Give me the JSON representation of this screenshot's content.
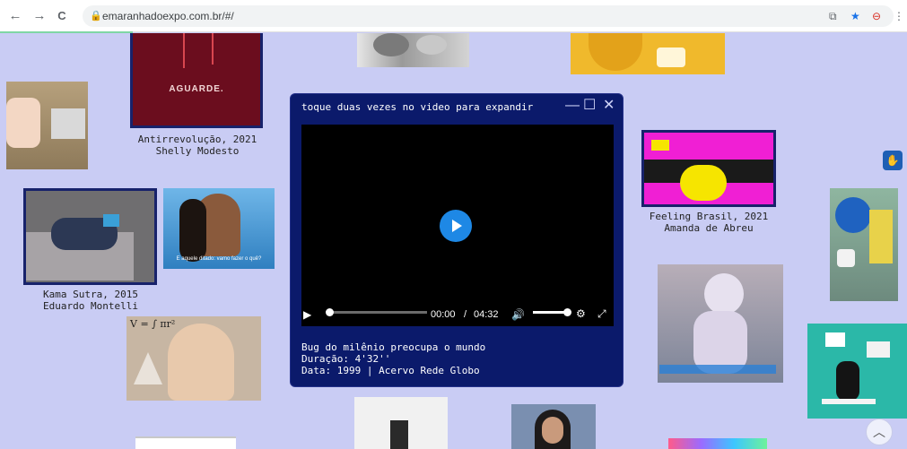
{
  "browser": {
    "back_icon": "←",
    "forward_icon": "→",
    "reload_icon": "C",
    "lock_icon": "🔒",
    "url": "emaranhadoexpo.com.br/#/",
    "ext1": "⧉",
    "star_icon": "★",
    "ext2": "⊖",
    "menu_icon": "⋮"
  },
  "artworks": [
    {
      "title": "Antirrevolução, 2021",
      "artist": "Shelly Modesto",
      "overlay_text": "AGUARDE."
    },
    {
      "title": "Kama Sutra, 2015",
      "artist": "Eduardo Montelli"
    },
    {
      "title": "Feeling Brasil, 2021",
      "artist": "Amanda de Abreu"
    }
  ],
  "thumb_texts": {
    "speech_caption": "E aquele ditado: vamo fazer o quê?",
    "math_formula": "V = ∫ πr²"
  },
  "player": {
    "title": "toque duas vezes no video para expandir",
    "minimize": "—",
    "maximize": "☐",
    "close": "✕",
    "play_icon": "▶",
    "time_current": "00:00",
    "time_sep": "/",
    "time_total": "04:32",
    "volume_icon": "🔊",
    "settings_icon": "⚙",
    "fullscreen_icon": "⤢",
    "info_line1": "Bug do milênio preocupa o mundo",
    "info_line2": "Duração: 4'32''",
    "info_line3": "Data: 1999 | Acervo Rede Globo"
  },
  "side_button_icon": "✋",
  "scroll_top_icon": "︿"
}
